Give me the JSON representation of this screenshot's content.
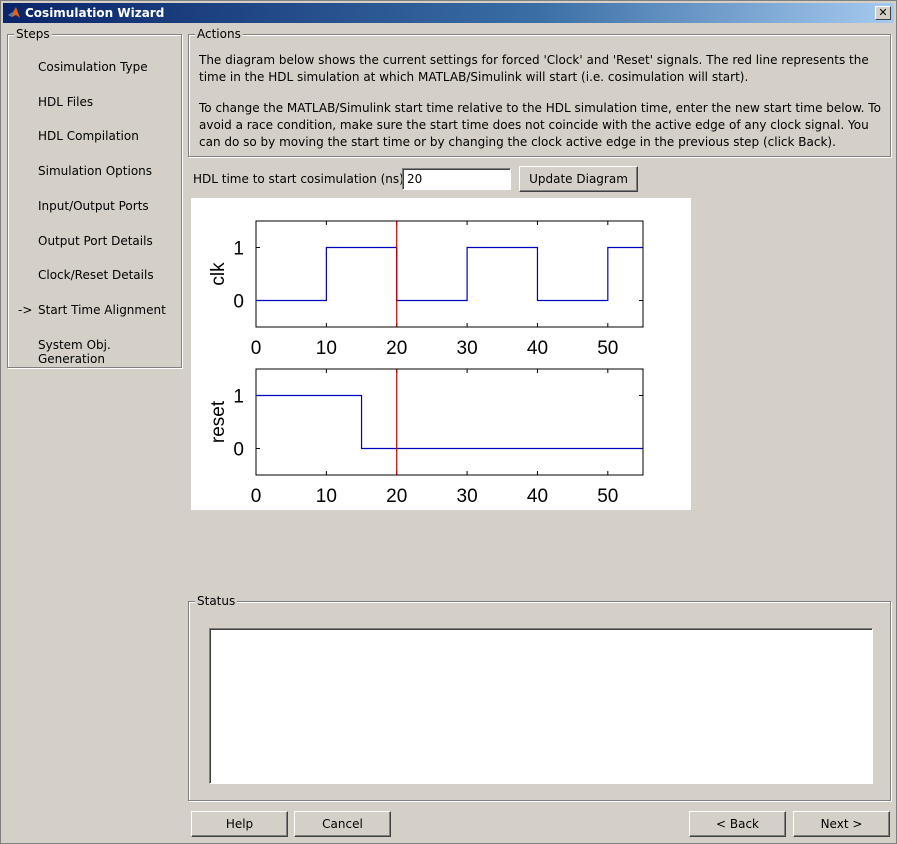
{
  "window": {
    "title": "Cosimulation Wizard",
    "close": "✕"
  },
  "steps": {
    "legend": "Steps",
    "current_marker": "->",
    "items": [
      {
        "label": "Cosimulation Type"
      },
      {
        "label": "HDL Files"
      },
      {
        "label": "HDL Compilation"
      },
      {
        "label": "Simulation Options"
      },
      {
        "label": "Input/Output Ports"
      },
      {
        "label": "Output Port Details"
      },
      {
        "label": "Clock/Reset Details"
      },
      {
        "label": "Start Time Alignment"
      },
      {
        "label": "System Obj. Generation"
      }
    ],
    "current_index": 7
  },
  "actions": {
    "legend": "Actions",
    "para1": "The diagram below shows the current settings for forced 'Clock' and 'Reset' signals. The red line represents the time in the HDL simulation at which MATLAB/Simulink will start (i.e. cosimulation will start).",
    "para2": "To change the MATLAB/Simulink start time relative to the HDL simulation time, enter the new start time below. To avoid a race condition, make sure the start time does not coincide with the active edge of any clock signal. You can do so by moving the start time or by changing the clock active edge in the previous step (click Back)."
  },
  "start_time": {
    "label": "HDL time to start cosimulation (ns):",
    "value": "20",
    "update_button": "Update Diagram"
  },
  "chart_data": [
    {
      "type": "line",
      "ylabel": "clk",
      "xlim": [
        0,
        55
      ],
      "ylim": [
        -0.5,
        1.5
      ],
      "xticks": [
        "0",
        "10",
        "20",
        "30",
        "40",
        "50"
      ],
      "yticks": [
        "0",
        "1"
      ],
      "start_time": 20,
      "colors": {
        "signal": "#0000c0",
        "start": "#c00000"
      },
      "steps": [
        [
          0,
          0
        ],
        [
          10,
          1
        ],
        [
          20,
          0
        ],
        [
          30,
          1
        ],
        [
          40,
          0
        ],
        [
          50,
          1
        ],
        [
          55,
          1
        ]
      ]
    },
    {
      "type": "line",
      "ylabel": "reset",
      "xlim": [
        0,
        55
      ],
      "ylim": [
        -0.5,
        1.5
      ],
      "xticks": [
        "0",
        "10",
        "20",
        "30",
        "40",
        "50"
      ],
      "yticks": [
        "0",
        "1"
      ],
      "start_time": 20,
      "colors": {
        "signal": "#0000c0",
        "start": "#c00000"
      },
      "steps": [
        [
          0,
          1
        ],
        [
          15,
          0
        ],
        [
          55,
          0
        ]
      ]
    }
  ],
  "status": {
    "legend": "Status",
    "text": ""
  },
  "buttons": {
    "help": "Help",
    "cancel": "Cancel",
    "back": "< Back",
    "next": "Next >"
  }
}
